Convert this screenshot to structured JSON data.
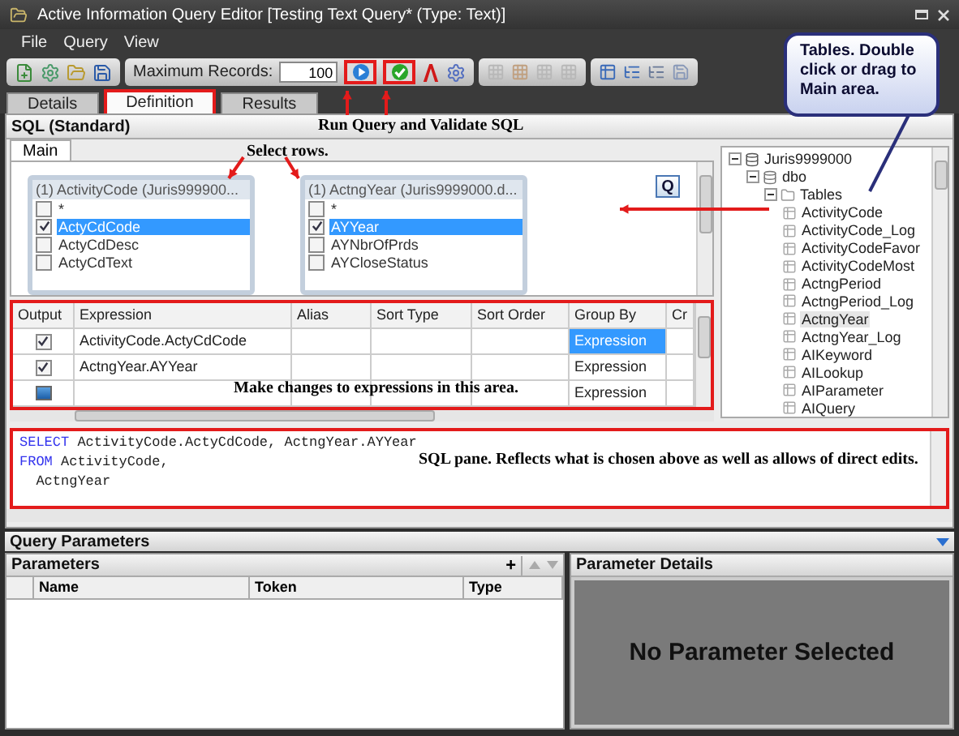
{
  "window": {
    "title": "Active Information Query Editor [Testing Text Query* (Type: Text)]"
  },
  "menu": [
    "File",
    "Query",
    "View"
  ],
  "toolbar": {
    "max_records_label": "Maximum Records:",
    "max_records_value": "100"
  },
  "tabs": [
    {
      "label": "Details",
      "selected": false
    },
    {
      "label": "Definition",
      "selected": true
    },
    {
      "label": "Results",
      "selected": false
    }
  ],
  "sql_panel": {
    "title": "SQL (Standard)"
  },
  "builder_tabs": [
    {
      "label": "Main",
      "selected": true
    }
  ],
  "tables": [
    {
      "title": "(1) ActivityCode (Juris999900...",
      "fields": [
        {
          "name": "*",
          "checked": false,
          "selected": false
        },
        {
          "name": "ActyCdCode",
          "checked": true,
          "selected": true
        },
        {
          "name": "ActyCdDesc",
          "checked": false,
          "selected": false
        },
        {
          "name": "ActyCdText",
          "checked": false,
          "selected": false
        }
      ]
    },
    {
      "title": "(1) ActngYear (Juris9999000.d...",
      "fields": [
        {
          "name": "*",
          "checked": false,
          "selected": false
        },
        {
          "name": "AYYear",
          "checked": true,
          "selected": true
        },
        {
          "name": "AYNbrOfPrds",
          "checked": false,
          "selected": false
        },
        {
          "name": "AYCloseStatus",
          "checked": false,
          "selected": false
        }
      ]
    }
  ],
  "query_button": "Q",
  "grid": {
    "columns": [
      "Output",
      "Expression",
      "Alias",
      "Sort Type",
      "Sort Order",
      "Group By",
      "Cr"
    ],
    "rows": [
      {
        "kind": "field",
        "output": true,
        "expression": "ActivityCode.ActyCdCode",
        "group_by": "Expression",
        "selected": true
      },
      {
        "kind": "field",
        "output": true,
        "expression": "ActngYear.AYYear",
        "group_by": "Expression",
        "selected": false
      },
      {
        "kind": "new",
        "group_by": "Expression",
        "selected": false
      }
    ]
  },
  "tree": [
    {
      "label": "Juris9999000",
      "kind": "database",
      "expanded": true,
      "selected": false,
      "children": [
        {
          "label": "dbo",
          "kind": "schema",
          "expanded": true,
          "selected": false,
          "children": [
            {
              "label": "Tables",
              "kind": "folder",
              "expanded": true,
              "selected": false,
              "children": [
                {
                  "label": "ActivityCode",
                  "kind": "table",
                  "selected": false
                },
                {
                  "label": "ActivityCode_Log",
                  "kind": "table",
                  "selected": false
                },
                {
                  "label": "ActivityCodeFavor",
                  "kind": "table",
                  "selected": false
                },
                {
                  "label": "ActivityCodeMost",
                  "kind": "table",
                  "selected": false
                },
                {
                  "label": "ActngPeriod",
                  "kind": "table",
                  "selected": false
                },
                {
                  "label": "ActngPeriod_Log",
                  "kind": "table",
                  "selected": false
                },
                {
                  "label": "ActngYear",
                  "kind": "table",
                  "selected": true
                },
                {
                  "label": "ActngYear_Log",
                  "kind": "table",
                  "selected": false
                },
                {
                  "label": "AIKeyword",
                  "kind": "table",
                  "selected": false
                },
                {
                  "label": "AILookup",
                  "kind": "table",
                  "selected": false
                },
                {
                  "label": "AIParameter",
                  "kind": "table",
                  "selected": false
                },
                {
                  "label": "AIQuery",
                  "kind": "table",
                  "selected": false
                }
              ]
            }
          ]
        }
      ]
    }
  ],
  "sql": [
    {
      "kind": "clause",
      "keyword": "SELECT",
      "text": "ActivityCode.ActyCdCode, ActngYear.AYYear"
    },
    {
      "kind": "clause",
      "keyword": "FROM",
      "text": "ActivityCode,"
    },
    {
      "kind": "continuation",
      "text": "ActngYear"
    }
  ],
  "query_parameters": {
    "title": "Query Parameters",
    "parameters": {
      "title": "Parameters",
      "add": "+",
      "columns": [
        "Name",
        "Token",
        "Type"
      ]
    },
    "details": {
      "title": "Parameter Details",
      "empty_message": "No Parameter Selected"
    }
  },
  "annotations": {
    "callout": "Tables. Double click or drag to Main area.",
    "run_validate": "Run Query and Validate SQL",
    "select_rows": "Select rows.",
    "expressions": "Make changes to expressions in this area.",
    "sql_pane": "SQL pane. Reflects what is chosen above as well as allows of direct edits."
  }
}
